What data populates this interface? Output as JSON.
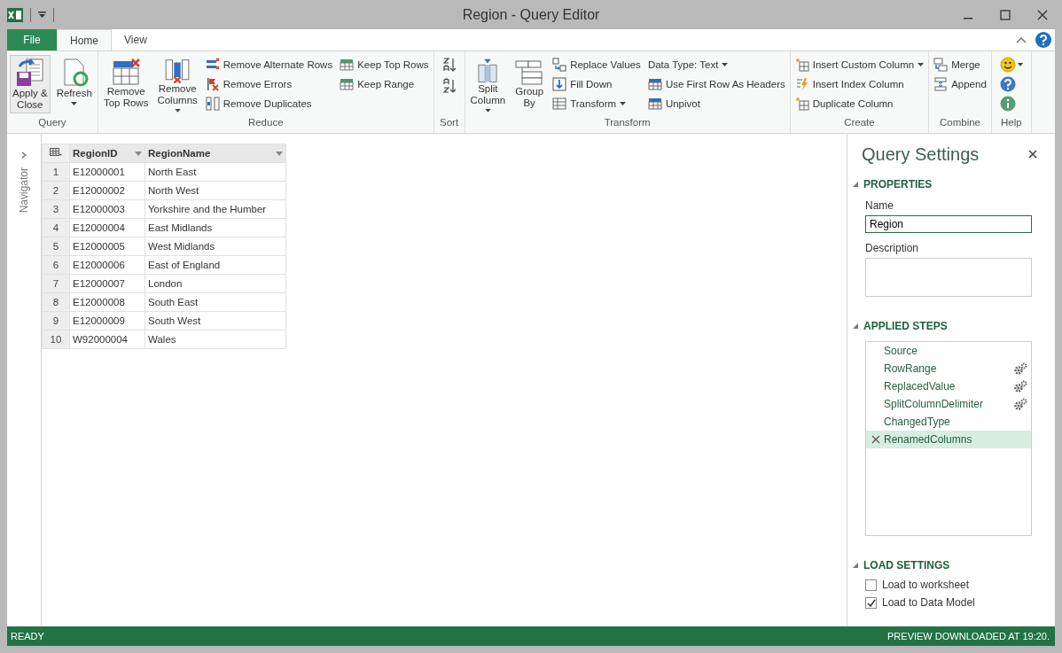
{
  "window": {
    "title": "Region - Query Editor"
  },
  "tabs": [
    {
      "label": "File",
      "kind": "file",
      "selected": false
    },
    {
      "label": "Home",
      "kind": "tab",
      "selected": true
    },
    {
      "label": "View",
      "kind": "tab",
      "selected": false
    }
  ],
  "ribbon": {
    "query": {
      "label": "Query",
      "buttons": [
        {
          "lines": [
            "Apply &",
            "Close"
          ],
          "dropdown": false
        },
        {
          "lines": [
            "Refresh"
          ],
          "dropdown": true
        }
      ]
    },
    "reduce": {
      "label": "Reduce",
      "large": [
        {
          "lines": [
            "Remove",
            "Top Rows"
          ],
          "dropdown": false
        },
        {
          "lines": [
            "Remove",
            "Columns"
          ],
          "dropdown": true
        }
      ],
      "small": [
        {
          "label": "Remove Alternate Rows"
        },
        {
          "label": "Remove Errors"
        },
        {
          "label": "Remove Duplicates"
        },
        {
          "label": "Keep Top Rows"
        },
        {
          "label": "Keep Range"
        }
      ]
    },
    "sort": {
      "label": "Sort"
    },
    "transform": {
      "label": "Transform",
      "large": [
        {
          "lines": [
            "Split",
            "Column"
          ],
          "dropdown": true
        },
        {
          "lines": [
            "Group",
            "By"
          ],
          "dropdown": false
        }
      ],
      "small": [
        {
          "label": "Replace Values",
          "dropdown": false
        },
        {
          "label": "Fill Down",
          "dropdown": false
        },
        {
          "label": "Transform",
          "dropdown": true
        },
        {
          "label": "Data Type: Text",
          "dropdown": true
        },
        {
          "label": "Use First Row As Headers",
          "dropdown": false
        },
        {
          "label": "Unpivot",
          "dropdown": false
        }
      ]
    },
    "create": {
      "label": "Create",
      "small": [
        {
          "label": "Insert Custom Column",
          "dropdown": true
        },
        {
          "label": "Insert Index Column",
          "dropdown": false
        },
        {
          "label": "Duplicate Column",
          "dropdown": false
        }
      ]
    },
    "combine": {
      "label": "Combine",
      "small": [
        {
          "label": "Merge"
        },
        {
          "label": "Append"
        }
      ]
    },
    "help": {
      "label": "Help"
    }
  },
  "navigator": {
    "label": "Navigator"
  },
  "table": {
    "columns": [
      {
        "label": "RegionID"
      },
      {
        "label": "RegionName"
      }
    ],
    "rows": [
      {
        "index": "1",
        "cells": [
          "E12000001",
          "North East"
        ]
      },
      {
        "index": "2",
        "cells": [
          "E12000002",
          "North West"
        ]
      },
      {
        "index": "3",
        "cells": [
          "E12000003",
          "Yorkshire and the Humber"
        ]
      },
      {
        "index": "4",
        "cells": [
          "E12000004",
          "East Midlands"
        ]
      },
      {
        "index": "5",
        "cells": [
          "E12000005",
          "West Midlands"
        ]
      },
      {
        "index": "6",
        "cells": [
          "E12000006",
          "East of England"
        ]
      },
      {
        "index": "7",
        "cells": [
          "E12000007",
          "London"
        ]
      },
      {
        "index": "8",
        "cells": [
          "E12000008",
          "South East"
        ]
      },
      {
        "index": "9",
        "cells": [
          "E12000009",
          "South West"
        ]
      },
      {
        "index": "10",
        "cells": [
          "W92000004",
          "Wales"
        ]
      }
    ]
  },
  "query_settings": {
    "title": "Query Settings",
    "properties": {
      "heading": "PROPERTIES",
      "name_label": "Name",
      "name_value": "Region",
      "description_label": "Description"
    },
    "applied_steps": {
      "heading": "APPLIED STEPS",
      "steps": [
        {
          "label": "Source",
          "has_settings": false,
          "selected": false
        },
        {
          "label": "RowRange",
          "has_settings": true,
          "selected": false
        },
        {
          "label": "ReplacedValue",
          "has_settings": true,
          "selected": false
        },
        {
          "label": "SplitColumnDelimiter",
          "has_settings": true,
          "selected": false
        },
        {
          "label": "ChangedType",
          "has_settings": false,
          "selected": false
        },
        {
          "label": "RenamedColumns",
          "has_settings": false,
          "selected": true
        }
      ]
    },
    "load_settings": {
      "heading": "LOAD SETTINGS",
      "options": [
        {
          "label": "Load to worksheet",
          "checked": false
        },
        {
          "label": "Load to Data Model",
          "checked": true
        }
      ]
    }
  },
  "status_bar": {
    "left": "READY",
    "right": "PREVIEW DOWNLOADED AT 19:20."
  }
}
